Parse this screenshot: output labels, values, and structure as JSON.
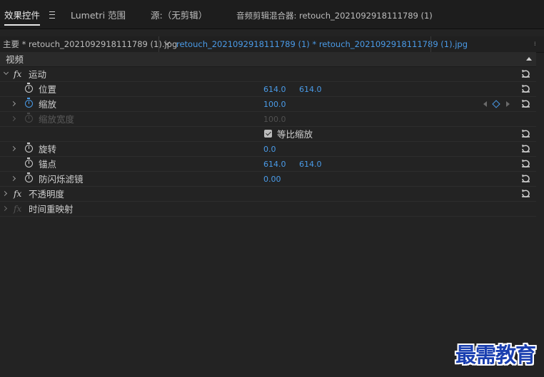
{
  "panel_tabs": [
    {
      "label": "效果控件",
      "active": true
    },
    {
      "label": "Lumetri 范围",
      "active": false
    },
    {
      "label": "源:（无剪辑）",
      "active": false
    },
    {
      "label": "音频剪辑混合器: retouch_2021092918111789 (1)",
      "active": false
    }
  ],
  "clips": {
    "master": "主要 * retouch_2021092918111789 (1).jpg",
    "sequence": "retouch_2021092918111789 (1) * retouch_2021092918111789 (1).jpg"
  },
  "section": {
    "video": "视频"
  },
  "effects": {
    "motion": {
      "label": "运动",
      "fx": "fx"
    },
    "opacity": {
      "label": "不透明度",
      "fx": "fx"
    },
    "time_remap": {
      "label": "时间重映射",
      "fx": "fx"
    }
  },
  "properties": {
    "position": {
      "label": "位置",
      "x": "614.0",
      "y": "614.0"
    },
    "scale": {
      "label": "缩放",
      "value": "100.0"
    },
    "scale_width": {
      "label": "缩放宽度",
      "value": "100.0"
    },
    "uniform_scale": {
      "label": "等比缩放",
      "checked": true
    },
    "rotation": {
      "label": "旋转",
      "value": "0.0"
    },
    "anchor": {
      "label": "锚点",
      "x": "614.0",
      "y": "614.0"
    },
    "anti_flicker": {
      "label": "防闪烁滤镜",
      "value": "0.00"
    }
  },
  "watermark": "最需教育",
  "colors": {
    "accent": "#4a9be8",
    "background": "#232323",
    "watermark": "#1a3fb0"
  }
}
